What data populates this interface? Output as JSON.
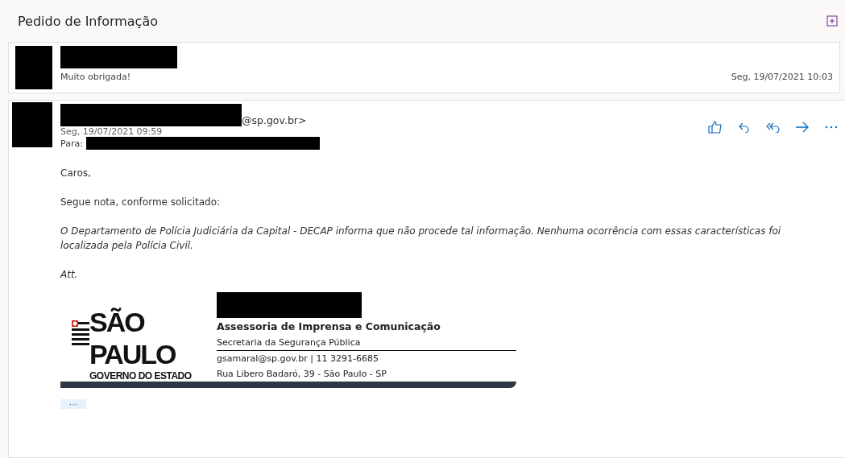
{
  "conversation": {
    "title": "Pedido de Informação"
  },
  "collapsed_message": {
    "preview": "Muito obrigada!",
    "date": "Seg, 19/07/2021 10:03"
  },
  "message": {
    "sender_suffix": "@sp.gov.br>",
    "date": "Seg, 19/07/2021 09:59",
    "to_label": "Para:",
    "body": [
      {
        "kind": "plain",
        "text": "Caros,"
      },
      {
        "kind": "plain",
        "text": "Segue nota, conforme solicitado:"
      },
      {
        "kind": "quote",
        "text": "O Departamento de Polícia Judiciária da Capital - DECAP informa que não procede tal informação. Nenhuma ocorrência com essas características foi localizada pela Polícia Civil."
      },
      {
        "kind": "quote",
        "text": "Att."
      }
    ],
    "signature": {
      "logo_top": "SÃO",
      "logo_bottom": "PAULO",
      "logo_caption": "GOVERNO DO ESTADO",
      "department": "Assessoria de Imprensa e Comunicação",
      "office": "Secretaria da Segurança Pública",
      "contact": "gsamaral@sp.gov.br | 11 3291-6685",
      "address": "Rua Libero Badaró, 39 - São Paulo - SP"
    },
    "more_label": "···"
  }
}
